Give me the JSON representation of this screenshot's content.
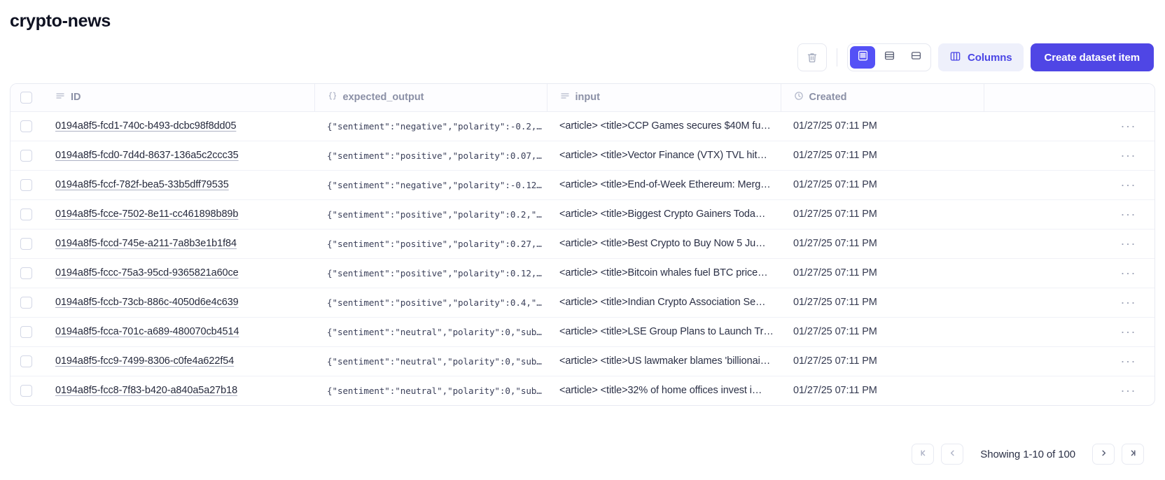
{
  "header": {
    "title": "crypto-news"
  },
  "toolbar": {
    "delete_icon": "trash-icon",
    "row_height_options": [
      {
        "icon": "rows-small-icon",
        "selected": true
      },
      {
        "icon": "rows-medium-icon",
        "selected": false
      },
      {
        "icon": "rows-large-icon",
        "selected": false
      }
    ],
    "columns_label": "Columns",
    "columns_icon": "columns-icon",
    "create_label": "Create dataset item",
    "accent_color": "#4f46e5",
    "columns_btn_bg": "#eef0fb",
    "columns_btn_fg": "#4b46e5"
  },
  "table": {
    "columns": [
      {
        "key": "id",
        "label": "ID",
        "icon": "text-lines-icon"
      },
      {
        "key": "expected_output",
        "label": "expected_output",
        "icon": "braces-icon"
      },
      {
        "key": "input",
        "label": "input",
        "icon": "text-lines-icon"
      },
      {
        "key": "created",
        "label": "Created",
        "icon": "clock-icon"
      }
    ],
    "row_menu_glyph": "···",
    "rows": [
      {
        "id": "0194a8f5-fcd1-740c-b493-dcbc98f8dd05",
        "expected_output": "{\"sentiment\":\"negative\",\"polarity\":-0.2,\"su…",
        "input": "<article> <title>CCP Games secures $40M fu…",
        "created": "01/27/25 07:11 PM"
      },
      {
        "id": "0194a8f5-fcd0-7d4d-8637-136a5c2ccc35",
        "expected_output": "{\"sentiment\":\"positive\",\"polarity\":0.07,\"su…",
        "input": "<article> <title>Vector Finance (VTX) TVL hit…",
        "created": "01/27/25 07:11 PM"
      },
      {
        "id": "0194a8f5-fccf-782f-bea5-33b5dff79535",
        "expected_output": "{\"sentiment\":\"negative\",\"polarity\":-0.12,\"s…",
        "input": "<article> <title>End-of-Week Ethereum: Merg…",
        "created": "01/27/25 07:11 PM"
      },
      {
        "id": "0194a8f5-fcce-7502-8e11-cc461898b89b",
        "expected_output": "{\"sentiment\":\"positive\",\"polarity\":0.2,\"sub…",
        "input": "<article> <title>Biggest Crypto Gainers Toda…",
        "created": "01/27/25 07:11 PM"
      },
      {
        "id": "0194a8f5-fccd-745e-a211-7a8b3e1b1f84",
        "expected_output": "{\"sentiment\":\"positive\",\"polarity\":0.27,\"su…",
        "input": "<article> <title>Best Crypto to Buy Now 5 Ju…",
        "created": "01/27/25 07:11 PM"
      },
      {
        "id": "0194a8f5-fccc-75a3-95cd-9365821a60ce",
        "expected_output": "{\"sentiment\":\"positive\",\"polarity\":0.12,\"su…",
        "input": "<article> <title>Bitcoin whales fuel BTC price…",
        "created": "01/27/25 07:11 PM"
      },
      {
        "id": "0194a8f5-fccb-73cb-886c-4050d6e4c639",
        "expected_output": "{\"sentiment\":\"positive\",\"polarity\":0.4,\"sub…",
        "input": "<article> <title>Indian Crypto Association Se…",
        "created": "01/27/25 07:11 PM"
      },
      {
        "id": "0194a8f5-fcca-701c-a689-480070cb4514",
        "expected_output": "{\"sentiment\":\"neutral\",\"polarity\":0,\"subjec…",
        "input": "<article> <title>LSE Group Plans to Launch Tr…",
        "created": "01/27/25 07:11 PM"
      },
      {
        "id": "0194a8f5-fcc9-7499-8306-c0fe4a622f54",
        "expected_output": "{\"sentiment\":\"neutral\",\"polarity\":0,\"subjec…",
        "input": "<article> <title>US lawmaker blames 'billionai…",
        "created": "01/27/25 07:11 PM"
      },
      {
        "id": "0194a8f5-fcc8-7f83-b420-a840a5a27b18",
        "expected_output": "{\"sentiment\":\"neutral\",\"polarity\":0,\"subjec…",
        "input": "<article> <title>32% of home offices invest i…",
        "created": "01/27/25 07:11 PM"
      }
    ]
  },
  "pagination": {
    "first_icon": "chevron-first-icon",
    "prev_icon": "chevron-left-icon",
    "next_icon": "chevron-right-icon",
    "last_icon": "chevron-last-icon",
    "status": "Showing 1-10 of 100"
  }
}
